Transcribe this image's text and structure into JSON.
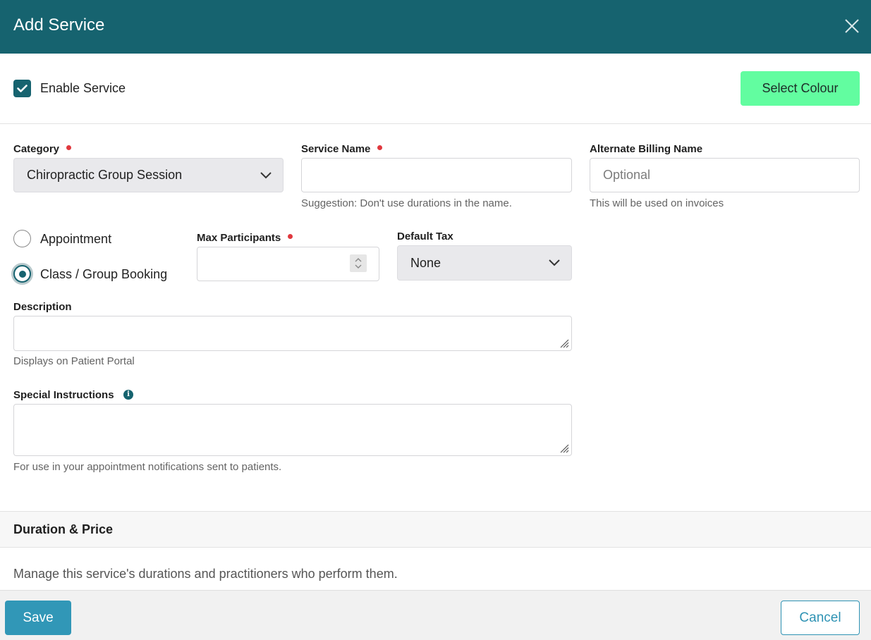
{
  "header": {
    "title": "Add Service",
    "close_icon": "close-icon"
  },
  "enable": {
    "label": "Enable Service",
    "checked": true,
    "select_colour_label": "Select Colour"
  },
  "category": {
    "label": "Category",
    "required": true,
    "value": "Chiropractic Group Session"
  },
  "service_name": {
    "label": "Service Name",
    "required": true,
    "value": "",
    "hint": "Suggestion: Don't use durations in the name."
  },
  "alt_billing": {
    "label": "Alternate Billing Name",
    "placeholder": "Optional",
    "hint": "This will be used on invoices"
  },
  "booking_type": {
    "options": [
      {
        "label": "Appointment",
        "checked": false
      },
      {
        "label": "Class / Group Booking",
        "checked": true
      }
    ]
  },
  "max_participants": {
    "label": "Max Participants",
    "required": true,
    "value": ""
  },
  "default_tax": {
    "label": "Default Tax",
    "value": "None"
  },
  "description": {
    "label": "Description",
    "value": "",
    "hint": "Displays on Patient Portal"
  },
  "special_instructions": {
    "label": "Special Instructions",
    "value": "",
    "hint": "For use in your appointment notifications sent to patients.",
    "info_icon": "info-icon"
  },
  "duration_price": {
    "title": "Duration & Price",
    "description": "Manage this service's durations and practitioners who perform them."
  },
  "footer": {
    "save_label": "Save",
    "cancel_label": "Cancel"
  },
  "colors": {
    "header": "#16636f",
    "accent": "#16636f",
    "select_colour": "#62fda0",
    "save": "#3197b7",
    "required": "#e0383e"
  }
}
